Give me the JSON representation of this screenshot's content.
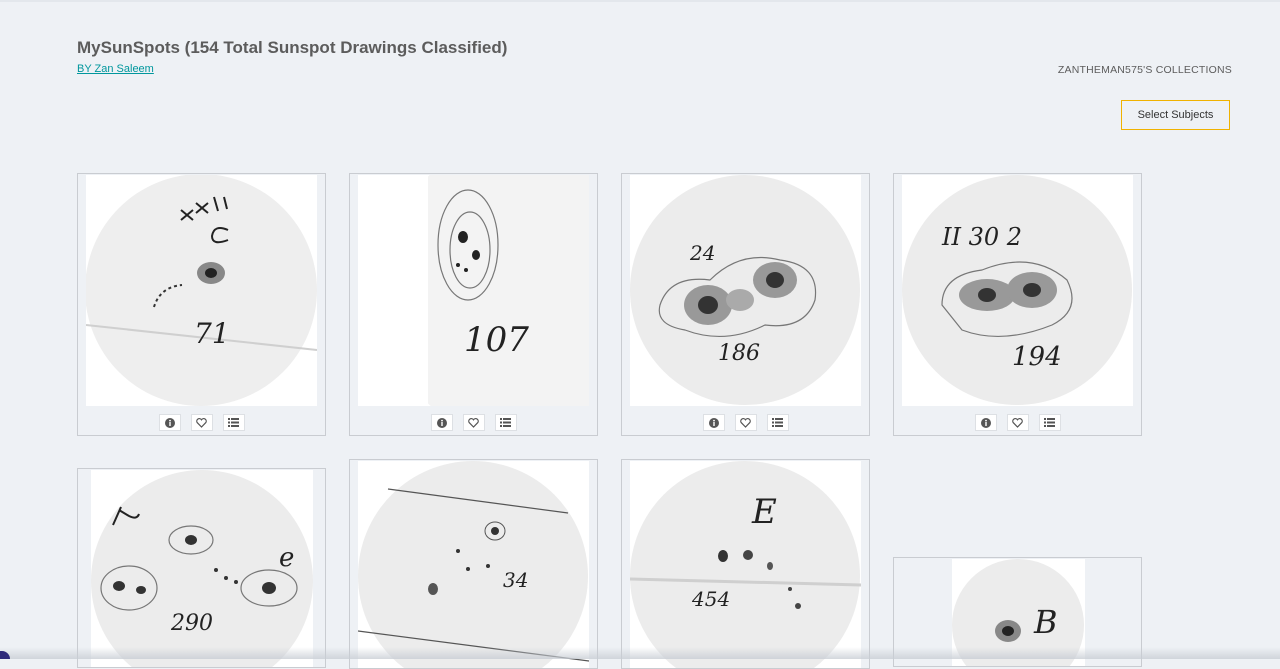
{
  "collection": {
    "title": "MySunSpots (154 Total Sunspot Drawings Classified)",
    "byline": "BY Zan Saleem",
    "owner": "ZANTHEMAN575'S COLLECTIONS"
  },
  "actions": {
    "select_subjects": "Select Subjects"
  },
  "icons": {
    "info": "info-icon",
    "favorite": "heart-icon",
    "add_to_collection": "list-icon"
  },
  "subjects": [
    {
      "label": "71",
      "marks": "XXI C"
    },
    {
      "label": "107",
      "marks": ""
    },
    {
      "label": "186",
      "marks": "24"
    },
    {
      "label": "194",
      "marks": "II 30 2"
    },
    {
      "label": "290",
      "marks": "e"
    },
    {
      "label": "34",
      "marks": ""
    },
    {
      "label": "454",
      "marks": "E"
    },
    {
      "label": "",
      "marks": "B"
    }
  ]
}
